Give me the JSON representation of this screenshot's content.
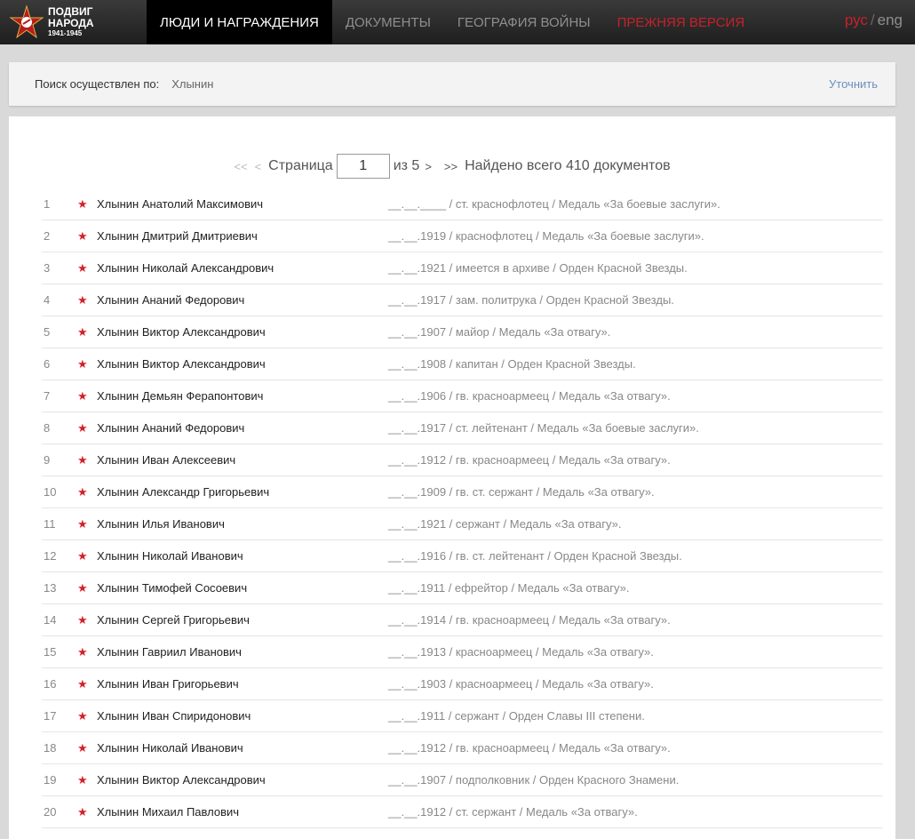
{
  "logo": {
    "line1": "ПОДВИГ",
    "line2": "НАРОДА",
    "years": "1941-1945"
  },
  "nav": {
    "items": [
      {
        "label": "ЛЮДИ И НАГРАЖДЕНИЯ"
      },
      {
        "label": "ДОКУМЕНТЫ"
      },
      {
        "label": "ГЕОГРАФИЯ ВОЙНЫ"
      },
      {
        "label": "ПРЕЖНЯЯ ВЕРСИЯ"
      }
    ],
    "lang_ru": "рус",
    "lang_sep": "/",
    "lang_en": "eng"
  },
  "search": {
    "label": "Поиск осуществлен по:",
    "value": "Хлынин",
    "refine": "Уточнить"
  },
  "pager": {
    "first": "<<",
    "prev": "<",
    "page_label": "Страница",
    "page": "1",
    "of": "из 5",
    "next": ">",
    "last": ">>",
    "total": "Найдено всего 410 документов"
  },
  "rows": [
    {
      "n": "1",
      "name": "Хлынин Анатолий Максимович",
      "details": "__.__.____ /  ст. краснофлотец /  Медаль «За боевые заслуги»."
    },
    {
      "n": "2",
      "name": "Хлынин Дмитрий Дмитриевич",
      "details": "__.__.1919 /  краснофлотец /  Медаль «За боевые заслуги»."
    },
    {
      "n": "3",
      "name": "Хлынин Николай Александрович",
      "details": "__.__.1921 /  имеется в архиве /  Орден Красной Звезды."
    },
    {
      "n": "4",
      "name": "Хлынин Ананий Федорович",
      "details": "__.__.1917 /  зам. политрука /  Орден Красной Звезды."
    },
    {
      "n": "5",
      "name": "Хлынин Виктор Александрович",
      "details": "__.__.1907 /  майор /  Медаль «За отвагу»."
    },
    {
      "n": "6",
      "name": "Хлынин Виктор Александрович",
      "details": "__.__.1908 /  капитан /  Орден Красной Звезды."
    },
    {
      "n": "7",
      "name": "Хлынин Демьян Ферапонтович",
      "details": "__.__.1906 /  гв. красноармеец /  Медаль «За отвагу»."
    },
    {
      "n": "8",
      "name": "Хлынин Ананий Федорович",
      "details": "__.__.1917 /  ст. лейтенант /  Медаль «За боевые заслуги»."
    },
    {
      "n": "9",
      "name": "Хлынин Иван Алексеевич",
      "details": "__.__.1912 /  гв. красноармеец /  Медаль «За отвагу»."
    },
    {
      "n": "10",
      "name": "Хлынин Александр Григорьевич",
      "details": "__.__.1909 /  гв. ст. сержант /  Медаль «За отвагу»."
    },
    {
      "n": "11",
      "name": "Хлынин Илья Иванович",
      "details": "__.__.1921 /  сержант /  Медаль «За отвагу»."
    },
    {
      "n": "12",
      "name": "Хлынин Николай Иванович",
      "details": "__.__.1916 /  гв. ст. лейтенант /  Орден Красной Звезды."
    },
    {
      "n": "13",
      "name": "Хлынин Тимофей Сосоевич",
      "details": "__.__.1911 /  ефрейтор /  Медаль «За отвагу»."
    },
    {
      "n": "14",
      "name": "Хлынин Сергей Григорьевич",
      "details": "__.__.1914 /  гв. красноармеец /  Медаль «За отвагу»."
    },
    {
      "n": "15",
      "name": "Хлынин Гавриил Иванович",
      "details": "__.__.1913 /  красноармеец /  Медаль «За отвагу»."
    },
    {
      "n": "16",
      "name": "Хлынин Иван Григорьевич",
      "details": "__.__.1903 /  красноармеец /  Медаль «За отвагу»."
    },
    {
      "n": "17",
      "name": "Хлынин Иван Спиридонович",
      "details": "__.__.1911 /  сержант /  Орден Славы III степени."
    },
    {
      "n": "18",
      "name": "Хлынин Николай Иванович",
      "details": "__.__.1912 /  гв. красноармеец /  Медаль «За отвагу»."
    },
    {
      "n": "19",
      "name": "Хлынин Виктор Александрович",
      "details": "__.__.1907 /  подполковник /  Орден Красного Знамени."
    },
    {
      "n": "20",
      "name": "Хлынин Михаил Павлович",
      "details": "__.__.1912 /  ст. сержант /  Медаль «За отвагу»."
    }
  ]
}
